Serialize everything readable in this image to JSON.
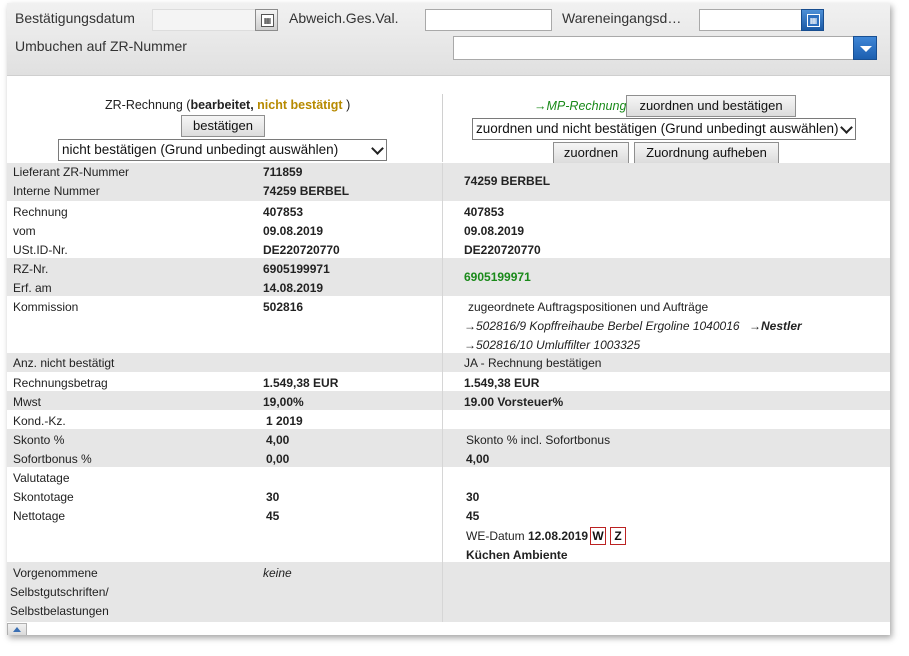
{
  "filter": {
    "bestaetigungsdatum_label": "Bestätigungsdatum",
    "bestaetigungsdatum_value": "",
    "abweich_label": "Abweich.Ges.Val.",
    "abweich_value": "",
    "wareneingang_label": "Wareneingangsd…",
    "wareneingang_value": "",
    "umbuchen_label": "Umbuchen auf ZR-Nummer",
    "umbuchen_value": "",
    "calendar_icon": "calendar-icon"
  },
  "left_header": {
    "title": "ZR-Rechnung (",
    "status_processed": "bearbeitet,",
    "status_not_confirmed": "nicht bestätigt",
    "close_paren": ")",
    "confirm_button": "bestätigen",
    "reject_select": "nicht bestätigen (Grund unbedingt auswählen)"
  },
  "right_header": {
    "link": "→MP-Rechnung",
    "assign_confirm_button": "zuordnen und bestätigen",
    "assign_reject_select": "zuordnen und nicht bestätigen (Grund unbedingt auswählen)",
    "assign_button": "zuordnen",
    "unassign_button": "Zuordnung aufheben"
  },
  "rows": {
    "lieferant": {
      "label": "Lieferant ZR-Nummer",
      "zr": "711859"
    },
    "interne": {
      "label": "Interne Nummer",
      "zr": "74259 BERBEL",
      "mp": "74259 BERBEL"
    },
    "rechnung": {
      "label": "Rechnung",
      "zr": "407853",
      "mp": "407853"
    },
    "vom": {
      "label": "vom",
      "zr": "09.08.2019",
      "mp": "09.08.2019"
    },
    "ustid": {
      "label": "USt.ID-Nr.",
      "zr": "DE220720770",
      "mp": "DE220720770"
    },
    "rznr": {
      "label": "RZ-Nr.",
      "zr": "6905199971",
      "mp": "6905199971"
    },
    "erf": {
      "label": "Erf. am",
      "zr": "14.08.2019"
    },
    "kommission": {
      "label": "Kommission",
      "zr": "502816",
      "mp_title": "zugeordnete Auftragspositionen und Aufträge",
      "mp_line1": "→502816/9 Kopffreihaube Berbel Ergoline 1040016",
      "mp_line1_tag": "→Nestler",
      "mp_line2": "→502816/10 Umluffilter 1003325"
    },
    "anz": {
      "label": "Anz. nicht bestätigt",
      "mp": "JA - Rechnung bestätigen"
    },
    "betrag": {
      "label": "Rechnungsbetrag",
      "zr": "1.549,38 EUR",
      "mp": "1.549,38 EUR"
    },
    "mwst": {
      "label": "Mwst",
      "zr": "19,00%",
      "mp": "19.00 Vorsteuer%"
    },
    "kond": {
      "label": "Kond.-Kz.",
      "zr": "1 2019"
    },
    "skonto": {
      "label": "Skonto %",
      "zr": "4,00",
      "mp": "Skonto % incl. Sofortbonus"
    },
    "sofortbonus": {
      "label": "Sofortbonus %",
      "zr": "0,00",
      "mp": "4,00"
    },
    "valutatage": {
      "label": "Valutatage"
    },
    "skontotage": {
      "label": "Skontotage",
      "zr": "30",
      "mp": "30"
    },
    "nettotage": {
      "label": "Nettotage",
      "zr": "45",
      "mp": "45"
    },
    "we": {
      "label": "WE-Datum",
      "date": "12.08.2019",
      "w": "W",
      "z": "Z",
      "company": "Küchen Ambiente"
    },
    "vorgenommene": {
      "label1": "Vorgenommene",
      "label2": "Selbstgutschriften/",
      "label3": "Selbstbelastungen",
      "zr": "keine"
    }
  }
}
